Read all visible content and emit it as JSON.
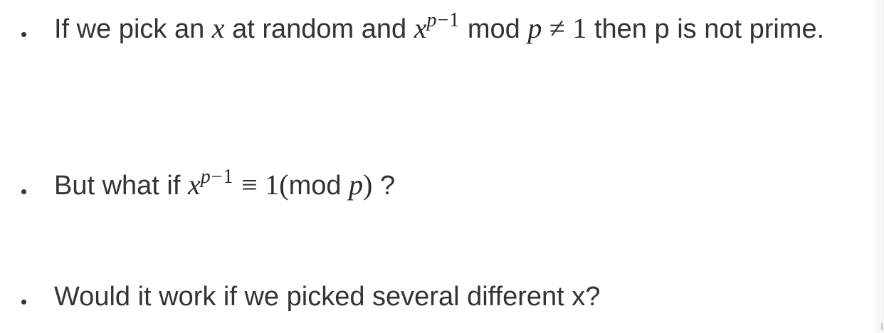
{
  "bullets": [
    {
      "text_before": "If we pick an",
      "var_x": "x",
      "text_at_random": "at random and",
      "power_base": "x",
      "power_exp_var": "p",
      "power_exp_rest": "−1",
      "text_mod": "mod",
      "var_p": "p",
      "neq": "≠",
      "one": "1",
      "text_after": "then p is not prime."
    },
    {
      "text_before": "But what if",
      "power_base": "x",
      "power_exp_var": "p",
      "power_exp_rest": "−1",
      "equiv": "≡",
      "one_paren": "1(",
      "text_mod": "mod",
      "var_p": "p",
      "close_paren": ")",
      "text_after": "?"
    },
    {
      "text": "Would it work if we picked several different x?"
    }
  ]
}
